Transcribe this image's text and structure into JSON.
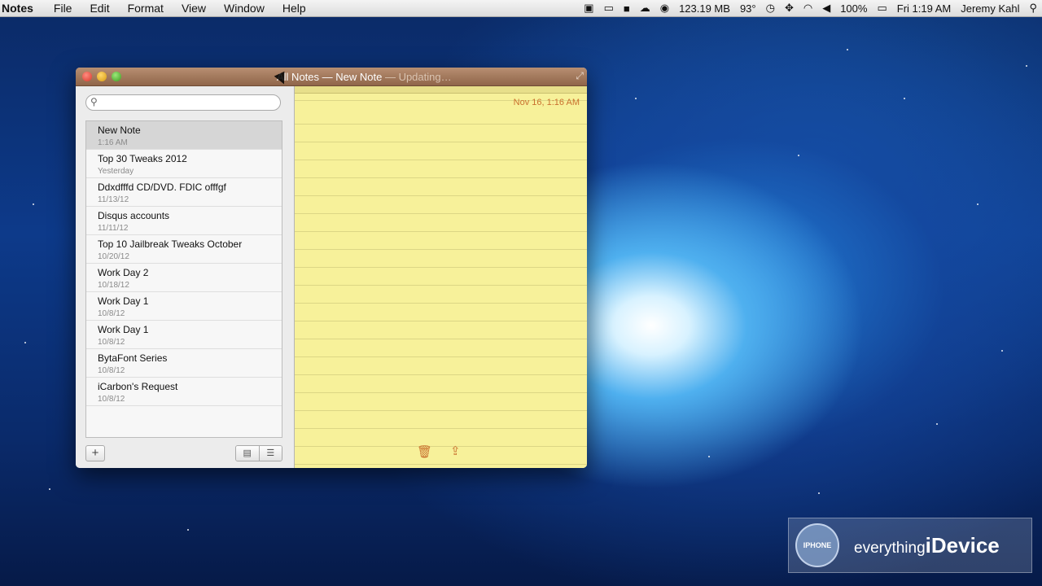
{
  "menubar": {
    "app_name": "Notes",
    "items": [
      "File",
      "Edit",
      "Format",
      "View",
      "Window",
      "Help"
    ],
    "status": {
      "memory": "123.19 MB",
      "temperature": "93°",
      "battery": "100%",
      "clock": "Fri 1:19 AM",
      "user": "Jeremy Kahl"
    },
    "icons": [
      "hash-icon",
      "video-icon",
      "folder-icon",
      "bell-icon",
      "lock-icon",
      "clock-icon",
      "move-icon",
      "wifi-icon",
      "volume-icon",
      "battery-icon",
      "search-icon"
    ]
  },
  "window": {
    "title_main": "All Notes — New Note",
    "title_status": "— Updating…"
  },
  "search": {
    "placeholder": ""
  },
  "notes": [
    {
      "title": "New Note",
      "date": "1:16 AM"
    },
    {
      "title": "Top 30 Tweaks 2012",
      "date": "Yesterday"
    },
    {
      "title": "Ddxdfffd CD/DVD. FDIC offfgf",
      "date": "11/13/12"
    },
    {
      "title": "Disqus accounts",
      "date": "11/11/12"
    },
    {
      "title": "Top 10 Jailbreak Tweaks October",
      "date": "10/20/12"
    },
    {
      "title": "Work Day 2",
      "date": "10/18/12"
    },
    {
      "title": "Work Day 1",
      "date": "10/8/12"
    },
    {
      "title": "Work Day 1",
      "date": "10/8/12"
    },
    {
      "title": "BytaFont Series",
      "date": "10/8/12"
    },
    {
      "title": "iCarbon's Request",
      "date": "10/8/12"
    }
  ],
  "editor": {
    "date_stamp": "Nov 16, 1:16 AM"
  },
  "watermark": {
    "prefix": "everything",
    "brand": "iDevice",
    "logo_text": "IPHONE"
  }
}
